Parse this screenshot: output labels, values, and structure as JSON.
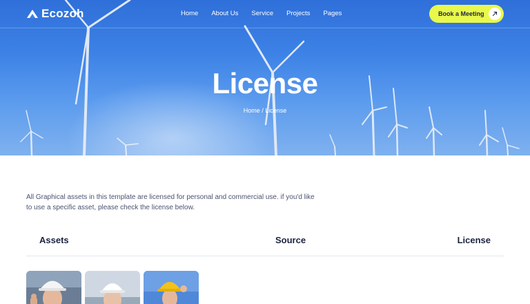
{
  "header": {
    "brand": "Ecozoh",
    "nav": [
      "Home",
      "About Us",
      "Service",
      "Projects",
      "Pages"
    ],
    "cta_label": "Book a Meeting"
  },
  "hero": {
    "title": "License",
    "breadcrumb": {
      "home": "Home",
      "separator": "/",
      "current": "License"
    }
  },
  "content": {
    "intro": "All Graphical assets in this template are licensed for personal and commercial use. if you'd like to use a specific asset, please check the license below.",
    "table": {
      "headers": [
        "Assets",
        "Source",
        "License"
      ]
    },
    "thumbnails": [
      "worker-white-helmet-thumbs-up",
      "worker-white-helmet",
      "worker-yellow-helmet"
    ]
  },
  "colors": {
    "accent": "#e9f84a",
    "text_dark": "#1c2340",
    "text_body": "#4a5270",
    "hero_blue": "#3d82e6"
  },
  "icons": {
    "logo": "leaf-mountain-icon",
    "cta": "arrow-up-right-icon"
  }
}
